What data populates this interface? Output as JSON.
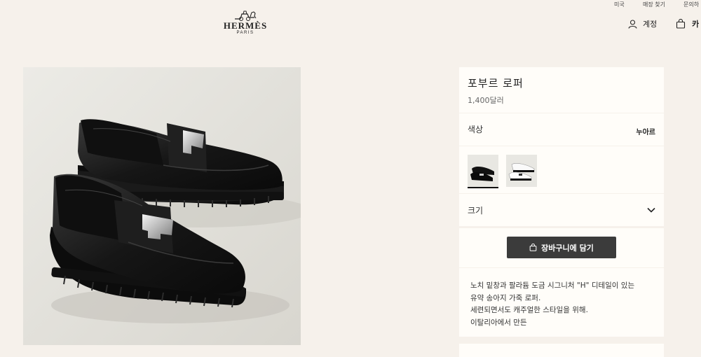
{
  "top_links": [
    "미국",
    "매장 찾기",
    "문의하"
  ],
  "brand": {
    "name": "HERMÈS",
    "city": "PARIS"
  },
  "header": {
    "account_label": "계정",
    "cart_label": "카"
  },
  "product": {
    "name": "포부르 로퍼",
    "price": "1,400달러",
    "color_label": "색상",
    "color_value": "누아르",
    "size_label": "크기",
    "add_to_cart": "장바구니에 담기",
    "description": [
      "노치 밑창과 팔라듐 도금 시그니처 \"H\" 디테일이 있는",
      "유약 송아지 가죽 로퍼.",
      "세련되면서도 캐주얼한 스타일을 위해.",
      "이탈리아에서 만든"
    ]
  },
  "colors": {
    "background": "#f6f1eb",
    "panel": "#fffdf9",
    "button": "#3b3b3b"
  },
  "icons": [
    "hermes-carriage-icon",
    "user-icon",
    "bag-icon",
    "chevron-down-icon"
  ]
}
